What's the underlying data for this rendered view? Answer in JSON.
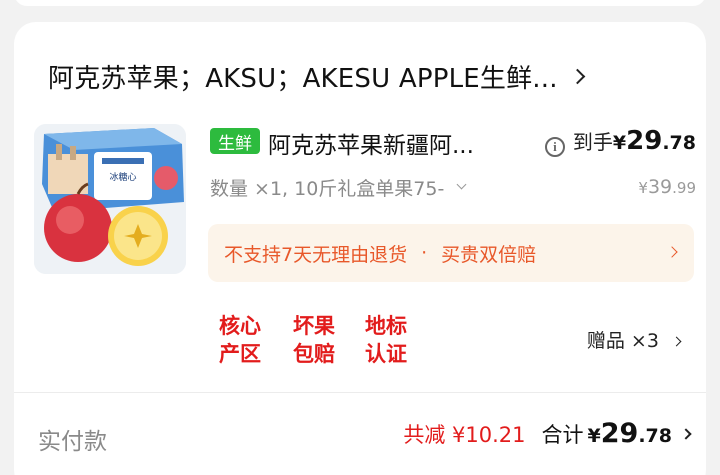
{
  "shop": {
    "name": "阿克苏苹果；AKSU；AKESU APPLE生鲜..."
  },
  "product": {
    "tag": "生鲜",
    "title": "阿克苏苹果新疆阿...",
    "spec": "数量 ×1, 10斤礼盒单果75-",
    "price_label": "到手",
    "currency": "¥",
    "price_int": "29",
    "price_dec": ".78",
    "orig_int": "39",
    "orig_dec": ".99",
    "thumb_text": "冰糖心"
  },
  "notice": {
    "left": "不支持7天无理由退货",
    "sep": "·",
    "right": "买贵双倍赔"
  },
  "badges": [
    {
      "line1": "核心",
      "line2": "产区"
    },
    {
      "line1": "坏果",
      "line2": "包赔"
    },
    {
      "line1": "地标",
      "line2": "认证"
    }
  ],
  "gift": {
    "label": "赠品 ×3"
  },
  "footer": {
    "paid_label": "实付款",
    "discount": "共减 ¥10.21",
    "total_label": "合计",
    "currency": "¥",
    "total_int": "29",
    "total_dec": ".78"
  },
  "colors": {
    "accent_red": "#e21c1c",
    "notice_orange": "#e8582a",
    "fresh_green": "#2dbb3e"
  }
}
